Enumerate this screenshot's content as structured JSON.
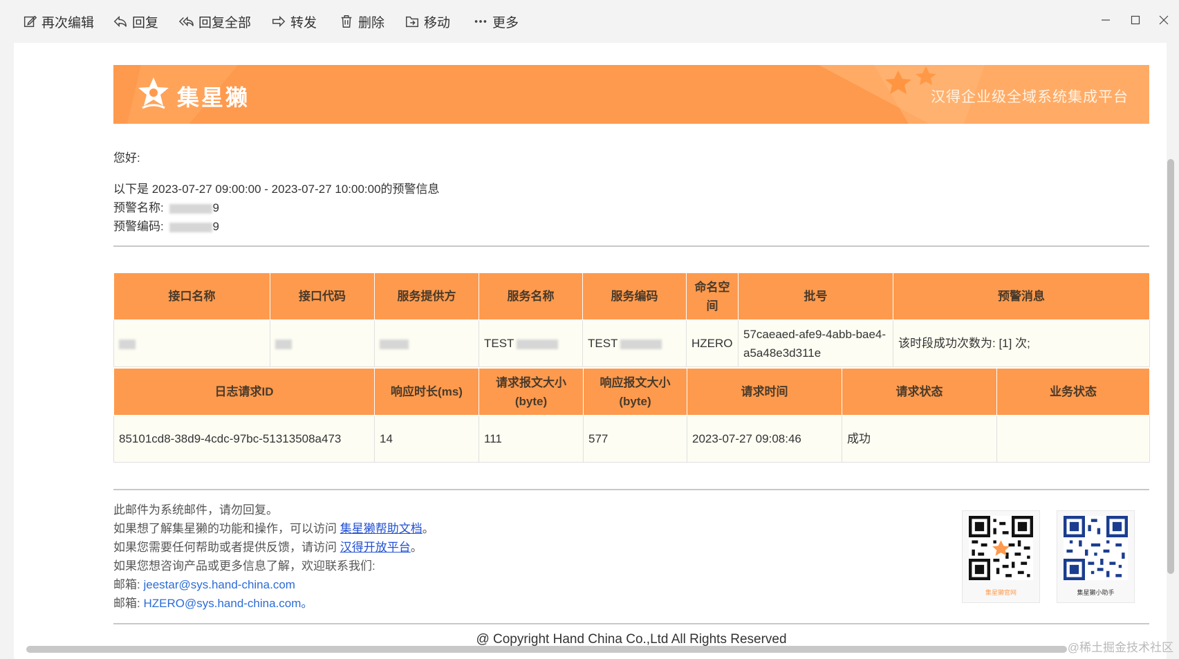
{
  "toolbar": {
    "items": [
      {
        "label": "再次编辑",
        "icon": "edit-icon"
      },
      {
        "label": "回复",
        "icon": "reply-icon"
      },
      {
        "label": "回复全部",
        "icon": "reply-all-icon"
      },
      {
        "label": "转发",
        "icon": "forward-icon"
      },
      {
        "label": "删除",
        "icon": "trash-icon"
      },
      {
        "label": "移动",
        "icon": "move-icon"
      },
      {
        "label": "更多",
        "icon": "more-icon"
      }
    ]
  },
  "banner": {
    "brand": "集星獭",
    "platform": "汉得企业级全域系统集成平台",
    "colors": {
      "primary": "#fe9a4d",
      "light": "#ffb06c"
    }
  },
  "email": {
    "greeting": "您好:",
    "intro": "以下是 2023-07-27 09:00:00 - 2023-07-27 10:00:00的预警信息",
    "alert_name_label": "预警名称:",
    "alert_name_tail": "9",
    "alert_code_label": "预警编码:",
    "alert_code_tail": "9"
  },
  "table1": {
    "headers": [
      "接口名称",
      "接口代码",
      "服务提供方",
      "服务名称",
      "服务编码",
      "命名空间",
      "批号",
      "预警消息"
    ],
    "row": {
      "service_name": "TEST",
      "service_code": "TEST",
      "namespace": "HZERO",
      "batch": "57caeaed-afe9-4abb-bae4-a5a48e3d311e",
      "message": "该时段成功次数为: [1] 次;"
    }
  },
  "table2": {
    "headers": [
      "日志请求ID",
      "响应时长(ms)",
      "请求报文大小(byte)",
      "响应报文大小(byte)",
      "请求时间",
      "请求状态",
      "业务状态"
    ],
    "row": {
      "log_id": "85101cd8-38d9-4cdc-97bc-51313508a473",
      "duration": "14",
      "req_size": "111",
      "resp_size": "577",
      "time": "2023-07-27 09:08:46",
      "status": "成功",
      "biz_status": ""
    }
  },
  "footer": {
    "line1": "此邮件为系统邮件，请勿回复。",
    "line2_pre": "如果想了解集星獭的功能和操作，可以访问",
    "line2_link": "集星獭帮助文档",
    "line2_post": "。",
    "line3_pre": "如果您需要任何帮助或者提供反馈，请访问",
    "line3_link": "汉得开放平台",
    "line3_post": "。",
    "line4": "如果您想咨询产品或更多信息了解，欢迎联系我们:",
    "mail_label": "邮箱:",
    "mail1": "jeestar@sys.hand-china.com",
    "mail2": "HZERO@sys.hand-china.com",
    "mail2_post": "。",
    "qr1_caption": "集星獭官网",
    "qr2_caption": "集星獭小助手",
    "copyright": "@ Copyright Hand China Co.,Ltd All Rights Reserved"
  },
  "watermark": "@稀土掘金技术社区"
}
